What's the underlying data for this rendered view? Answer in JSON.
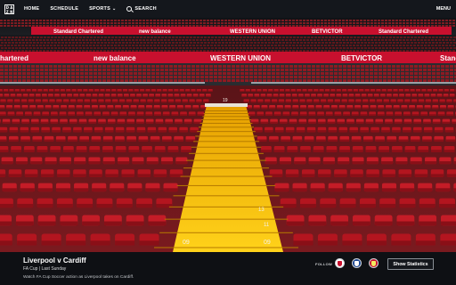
{
  "nav": {
    "logo_letters": [
      "D",
      "A",
      "Z",
      "N"
    ],
    "home": "HOME",
    "schedule": "SCHEDULE",
    "sports": "SPORTS",
    "sports_chevron": "⌄",
    "search": "SEARCH",
    "menu": "MENU"
  },
  "stadium_boards": {
    "upper": [
      "Standard Chartered",
      "new balance",
      "WESTERN UNION",
      "BETVICTOR",
      "Standard Chartered"
    ],
    "lower": [
      "hartered",
      "new balance",
      "WESTERN UNION",
      "BETVICTOR",
      "Standa"
    ],
    "row_numbers": [
      "19",
      "13",
      "11",
      "09",
      "09"
    ]
  },
  "event": {
    "title": "Liverpool v Cardiff",
    "meta": "FA Cup | Last Sunday",
    "description": "Watch FA Cup Soccer action as Liverpool takes on Cardiff."
  },
  "follow": {
    "label": "FOLLOW",
    "crests": [
      {
        "name": "fa-cup-crest",
        "color": "#ffffff",
        "inner": "#c8102e"
      },
      {
        "name": "cardiff-crest",
        "color": "#1b458f",
        "inner": "#ffffff"
      },
      {
        "name": "liverpool-crest",
        "color": "#c8102e",
        "inner": "#f6eb61"
      }
    ]
  },
  "actions": {
    "show_statistics": "Show Statistics"
  },
  "colors": {
    "board_red": "#c8102e",
    "seat_red": "#b3151f",
    "steps_yellow": "#f2b705"
  }
}
